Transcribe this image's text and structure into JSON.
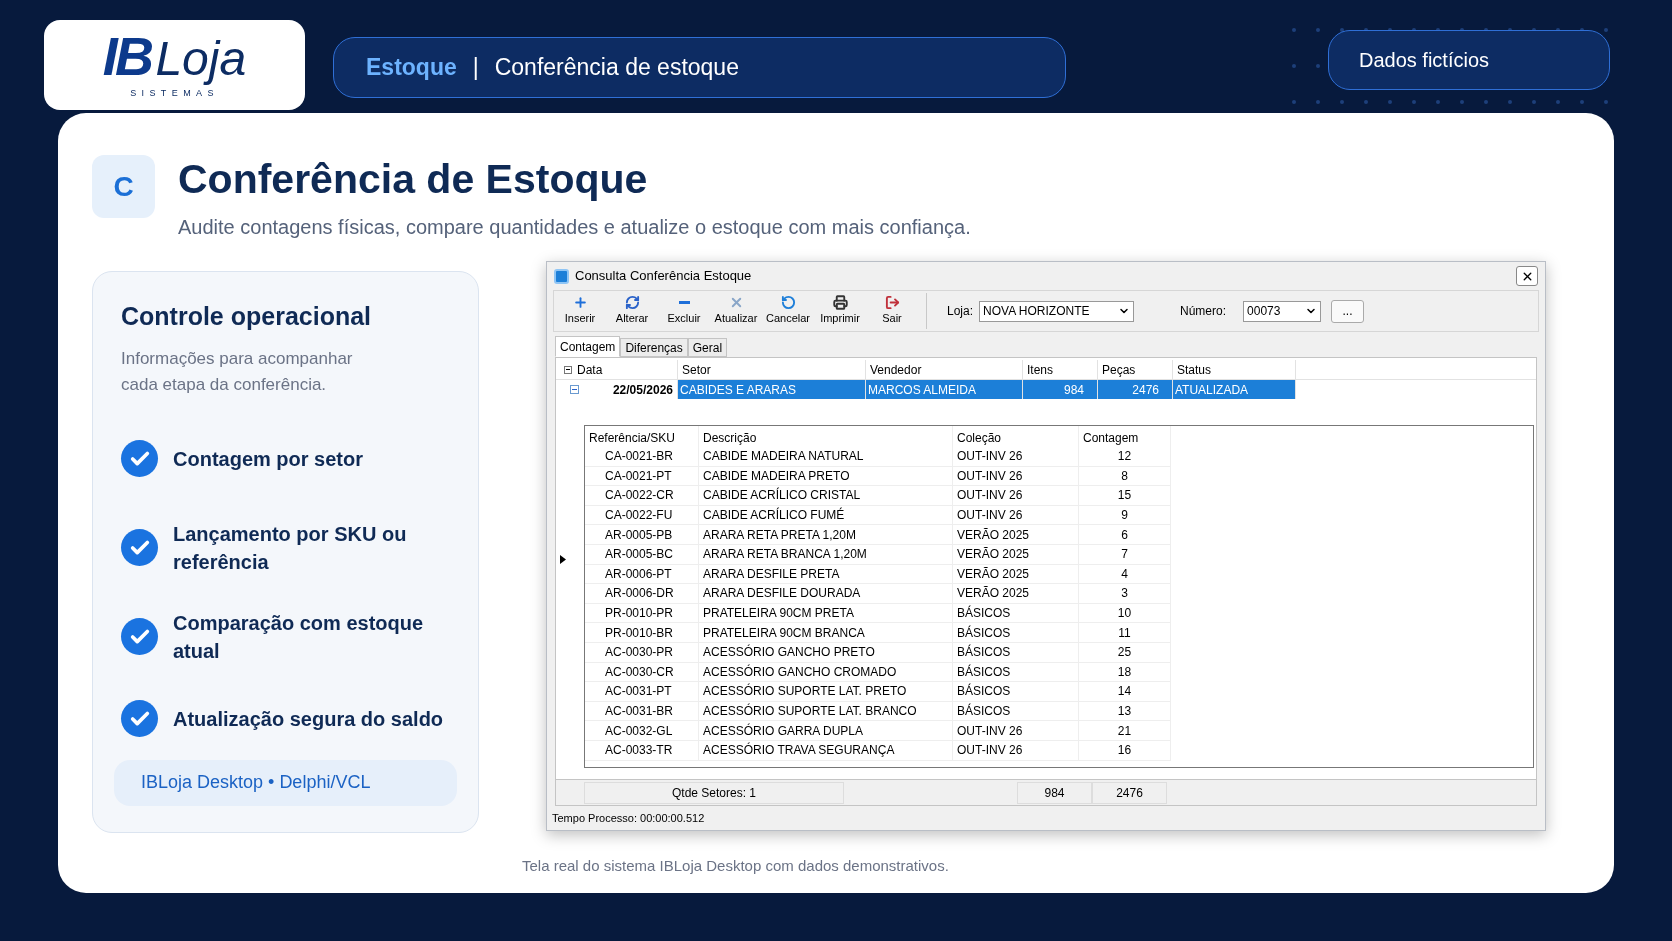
{
  "logo": {
    "mark": "IB",
    "name": "Loja",
    "tagline": "SISTEMAS"
  },
  "breadcrumb": {
    "section": "Estoque",
    "separator": "|",
    "page": "Conferência de estoque"
  },
  "badge": "Dados fictícios",
  "heading": {
    "icon_letter": "C",
    "title": "Conferência de Estoque",
    "subtitle": "Audite contagens físicas, compare quantidades e atualize o estoque com mais confiança."
  },
  "panel": {
    "title": "Controle operacional",
    "description": "Informações para acompanhar cada etapa da conferência.",
    "features": [
      {
        "label": "Contagem por setor",
        "checked": true
      },
      {
        "label": "Lançamento por SKU ou referência",
        "checked": true
      },
      {
        "label": "Comparação com estoque atual",
        "checked": true
      },
      {
        "label": "Atualização segura do saldo",
        "checked": true
      }
    ],
    "tag": "IBLoja Desktop • Delphi/VCL"
  },
  "window": {
    "title": "Consulta Conferência Estoque",
    "toolbar": [
      {
        "kind": "insert",
        "label": "Inserir"
      },
      {
        "kind": "edit",
        "label": "Alterar"
      },
      {
        "kind": "delete",
        "label": "Excluir"
      },
      {
        "kind": "refresh",
        "label": "Atualizar"
      },
      {
        "kind": "cancel",
        "label": "Cancelar"
      },
      {
        "kind": "print",
        "label": "Imprimir"
      },
      {
        "kind": "exit",
        "label": "Sair"
      }
    ],
    "loja": {
      "label": "Loja:",
      "value": "NOVA HORIZONTE"
    },
    "numero": {
      "label": "Número:",
      "value": "00073"
    },
    "more_button": "...",
    "tabs": [
      {
        "label": "Contagem",
        "selected": true
      },
      {
        "label": "Diferenças",
        "selected": false
      },
      {
        "label": "Geral",
        "selected": false
      }
    ],
    "master": {
      "columns": [
        "Data",
        "Setor",
        "Vendedor",
        "Itens",
        "Peças",
        "Status"
      ],
      "rows": [
        {
          "selected": true,
          "expanded": true,
          "cells": [
            "22/05/2026",
            "CABIDES E ARARAS",
            "MARCOS ALMEIDA",
            "984",
            "2476",
            "ATUALIZADA"
          ]
        }
      ]
    },
    "detail": {
      "columns": [
        "Referência/SKU",
        "Descrição",
        "Coleção",
        "Contagem"
      ],
      "rows": [
        [
          "CA-0021-BR",
          "CABIDE MADEIRA NATURAL",
          "OUT-INV 26",
          "12"
        ],
        [
          "CA-0021-PT",
          "CABIDE MADEIRA PRETO",
          "OUT-INV 26",
          "8"
        ],
        [
          "CA-0022-CR",
          "CABIDE ACRÍLICO CRISTAL",
          "OUT-INV 26",
          "15"
        ],
        [
          "CA-0022-FU",
          "CABIDE ACRÍLICO FUMÉ",
          "OUT-INV 26",
          "9"
        ],
        [
          "AR-0005-PB",
          "ARARA RETA PRETA 1,20M",
          "VERÃO 2025",
          "6"
        ],
        [
          "AR-0005-BC",
          "ARARA RETA BRANCA 1,20M",
          "VERÃO 2025",
          "7"
        ],
        [
          "AR-0006-PT",
          "ARARA DESFILE PRETA",
          "VERÃO 2025",
          "4"
        ],
        [
          "AR-0006-DR",
          "ARARA DESFILE DOURADA",
          "VERÃO 2025",
          "3"
        ],
        [
          "PR-0010-PR",
          "PRATELEIRA 90CM PRETA",
          "BÁSICOS",
          "10"
        ],
        [
          "PR-0010-BR",
          "PRATELEIRA 90CM BRANCA",
          "BÁSICOS",
          "11"
        ],
        [
          "AC-0030-PR",
          "ACESSÓRIO GANCHO PRETO",
          "BÁSICOS",
          "25"
        ],
        [
          "AC-0030-CR",
          "ACESSÓRIO GANCHO CROMADO",
          "BÁSICOS",
          "18"
        ],
        [
          "AC-0031-PT",
          "ACESSÓRIO SUPORTE LAT. PRETO",
          "BÁSICOS",
          "14"
        ],
        [
          "AC-0031-BR",
          "ACESSÓRIO SUPORTE LAT. BRANCO",
          "BÁSICOS",
          "13"
        ],
        [
          "AC-0032-GL",
          "ACESSÓRIO GARRA DUPLA",
          "OUT-INV 26",
          "21"
        ],
        [
          "AC-0033-TR",
          "ACESSÓRIO TRAVA SEGURANÇA",
          "OUT-INV 26",
          "16"
        ]
      ]
    },
    "footer": [
      "Qtde Setores: 1",
      "984",
      "2476"
    ],
    "status": "Tempo Processo: 00:00:00.512"
  },
  "caption": "Tela real do sistema IBLoja Desktop com dados demonstrativos."
}
